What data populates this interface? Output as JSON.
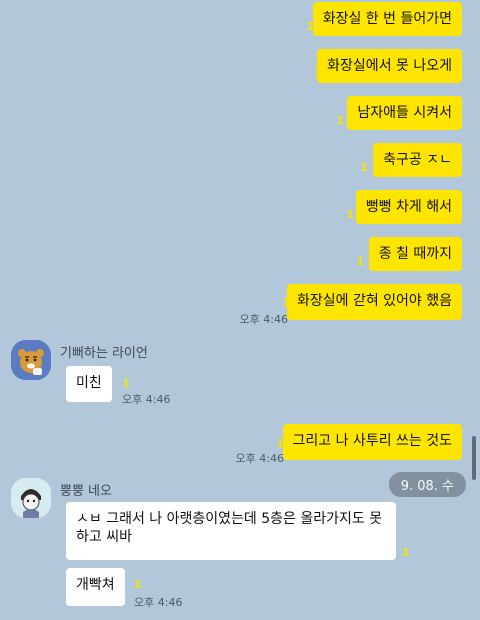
{
  "sent_top": [
    {
      "text": "화장실 한 번 들어가면",
      "unread": "1"
    },
    {
      "text": "화장실에서 못 나오게",
      "unread": "1"
    },
    {
      "text": "남자애들 시켜서",
      "unread": "1"
    },
    {
      "text": "축구공 ㅈㄴ",
      "unread": "1"
    },
    {
      "text": "뻥뻥 차게 해서",
      "unread": "1"
    },
    {
      "text": "종 칠 때까지",
      "unread": "1"
    },
    {
      "text": "화장실에 갇혀 있어야 했음",
      "unread": "1",
      "time": "오후 4:46"
    }
  ],
  "lion": {
    "name": "기뻐하는 라이언",
    "message": "미친",
    "unread": "1",
    "time": "오후 4:46",
    "avatar_icon": "ryan-character-icon"
  },
  "sent_mid": {
    "text": "그리고 나 사투리 쓰는 것도",
    "unread": "1",
    "time": "오후 4:46"
  },
  "date_badge": "9. 08. 수",
  "neo": {
    "name": "뿡뿡 네오",
    "avatar_icon": "neo-character-icon",
    "messages": [
      {
        "text": "ㅅㅂ 그래서 나 아랫층이였는데 5층은 올라가지도 못하고 씨바",
        "unread": "1"
      },
      {
        "text": "개빡쳐",
        "unread": "1"
      }
    ],
    "time": "오후 4:46"
  },
  "colors": {
    "background": "#b2c7d9",
    "sent_bubble": "#fee500",
    "received_bubble": "#ffffff",
    "unread": "#f7e600"
  }
}
